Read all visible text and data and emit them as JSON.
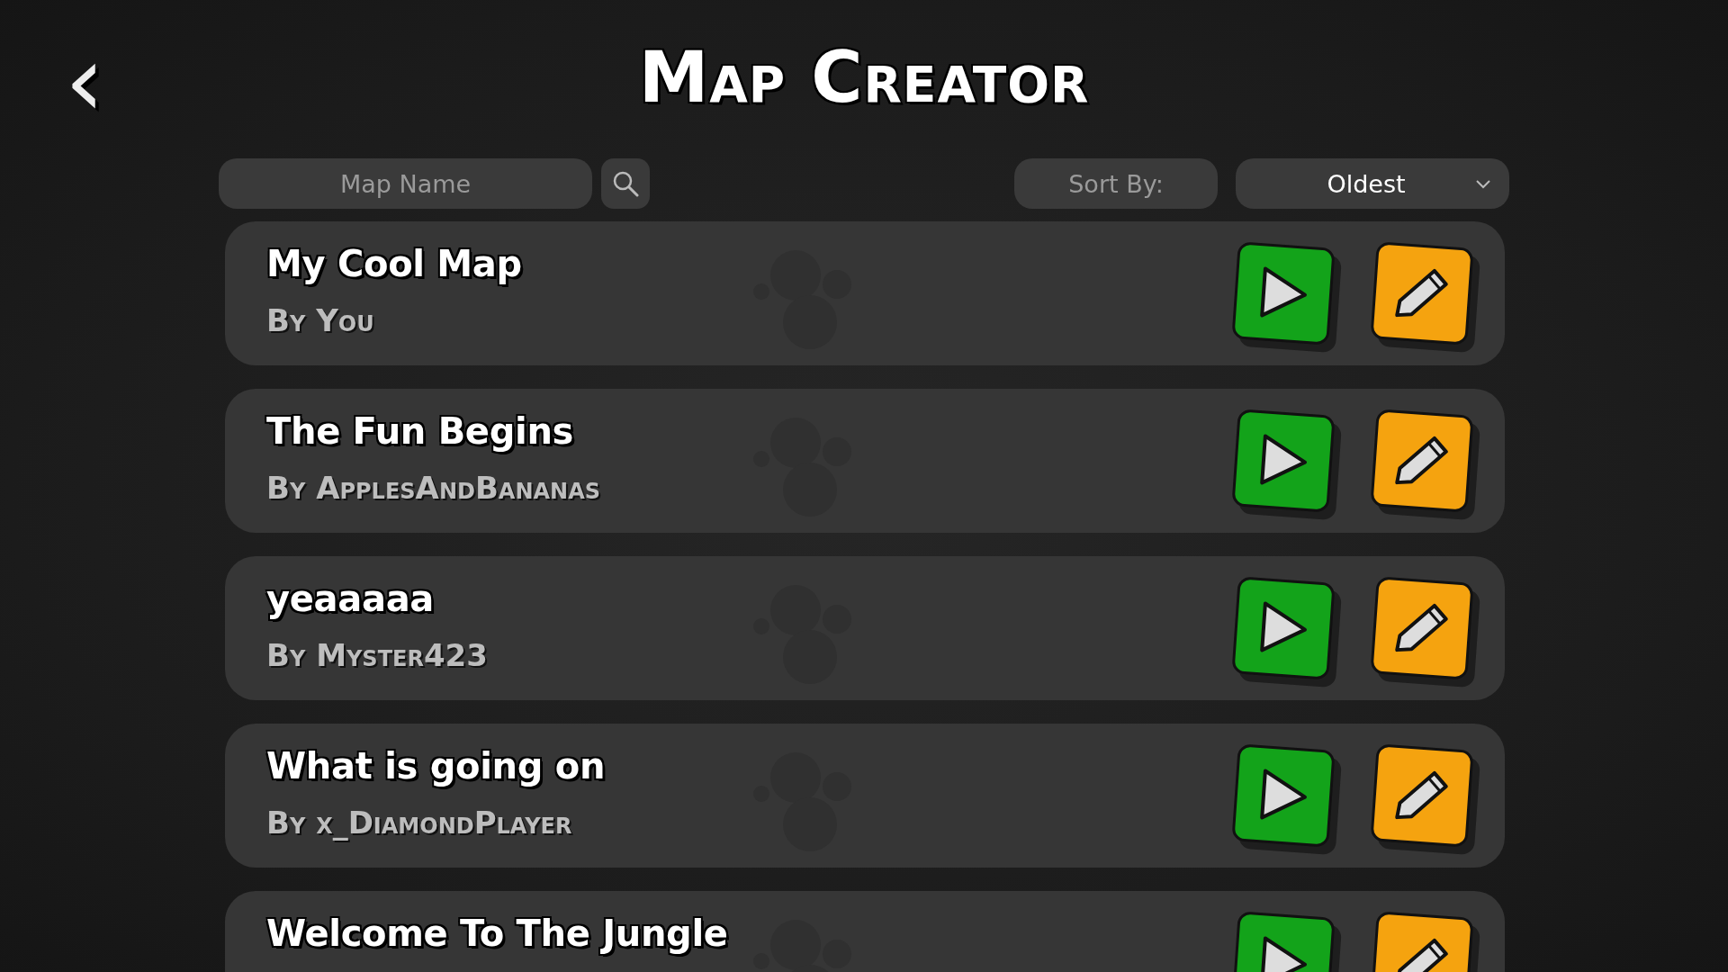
{
  "header": {
    "back": "‹",
    "title": "Map Creator"
  },
  "search": {
    "placeholder": "Map Name"
  },
  "sort": {
    "label": "Sort By:",
    "value": "Oldest"
  },
  "maps": [
    {
      "name": "My Cool Map",
      "author": "By You"
    },
    {
      "name": "The Fun Begins",
      "author": "By ApplesAndBananas"
    },
    {
      "name": "yeaaaaa",
      "author": "By Myster423"
    },
    {
      "name": "What is going on",
      "author": "By x_DiamondPlayer"
    },
    {
      "name": "Welcome To The Jungle"
    }
  ]
}
